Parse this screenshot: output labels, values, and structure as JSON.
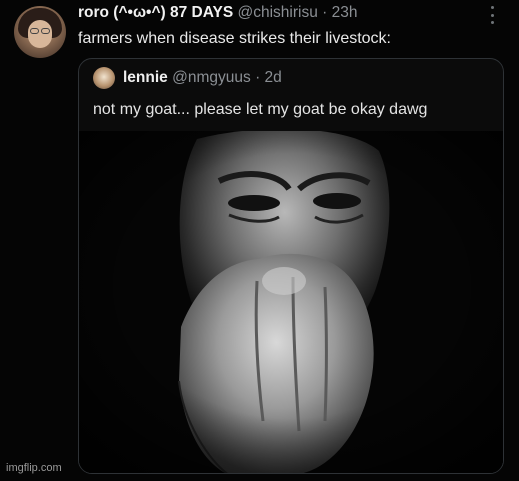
{
  "tweet": {
    "display_name": "roro (^•ω•^) 87 DAYS",
    "handle": "@chishirisu",
    "separator": "·",
    "time": "23h",
    "text": "farmers when disease strikes their livestock:"
  },
  "quoted_tweet": {
    "display_name": "lennie",
    "handle": "@nmgyuus",
    "separator": "·",
    "time": "2d",
    "text": "not my goat... please let my goat be okay dawg"
  },
  "icons": {
    "more": "more-vertical-icon"
  },
  "watermark": "imgflip.com",
  "colors": {
    "background": "#050505",
    "text_primary": "#e7e9ea",
    "text_secondary": "#8b8f94",
    "border": "#2e3236"
  }
}
